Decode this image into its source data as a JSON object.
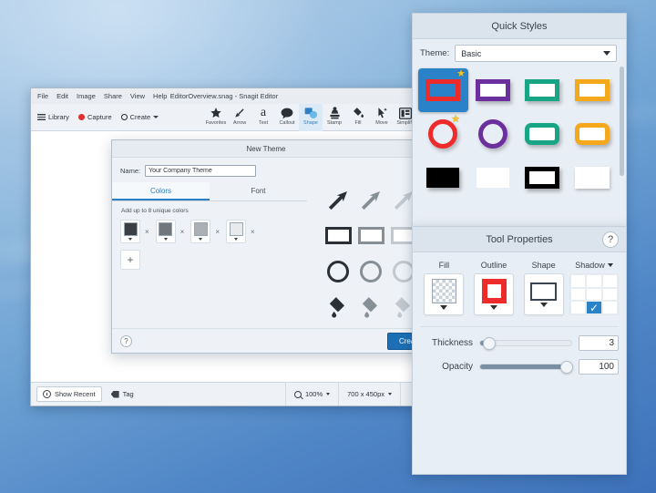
{
  "desktop": {
    "wallpaper_color": "#4f86c6"
  },
  "editor": {
    "title": "EditorOverview.snag - Snagit Editor",
    "menu": [
      "File",
      "Edit",
      "Image",
      "Share",
      "View",
      "Help"
    ],
    "toolbar_left": [
      {
        "label": "Library",
        "icon": "hamburger-icon"
      },
      {
        "label": "Capture",
        "icon": "record-dot-icon"
      },
      {
        "label": "Create",
        "icon": "circle-outline-icon"
      }
    ],
    "tools": [
      {
        "label": "Favorites",
        "icon": "star-icon",
        "active": false
      },
      {
        "label": "Arrow",
        "icon": "arrow-icon",
        "active": false
      },
      {
        "label": "Text",
        "icon": "text-a-icon",
        "active": false
      },
      {
        "label": "Callout",
        "icon": "callout-bubble-icon",
        "active": false
      },
      {
        "label": "Shape",
        "icon": "shape-icon",
        "active": true
      },
      {
        "label": "Stamp",
        "icon": "stamp-icon",
        "active": false
      },
      {
        "label": "Fill",
        "icon": "paint-bucket-icon",
        "active": false
      },
      {
        "label": "Move",
        "icon": "move-cursor-icon",
        "active": false
      },
      {
        "label": "Simplify",
        "icon": "simplify-icon",
        "active": false
      }
    ],
    "statusbar": {
      "show_recent": "Show Recent",
      "tag": "Tag",
      "zoom": "100%",
      "dimensions": "700 x 450px"
    }
  },
  "theme_dialog": {
    "title": "New Theme",
    "name_label": "Name:",
    "name_value": "Your Company Theme",
    "tabs": [
      {
        "label": "Colors",
        "selected": true
      },
      {
        "label": "Font",
        "selected": false
      }
    ],
    "hint": "Add up to 8 unique colors",
    "swatches": [
      {
        "color": "#3b3f44",
        "remove_label": "×"
      },
      {
        "color": "#6f767d",
        "remove_label": "×"
      },
      {
        "color": "#aab0b6",
        "remove_label": "×"
      },
      {
        "color": "#e8eaec",
        "remove_label": "×"
      }
    ],
    "add_label": "+",
    "help_label": "?",
    "create_label": "Create",
    "preview_rows": [
      {
        "kind": "arrow",
        "colors": [
          "#2b3036",
          "#868e96",
          "#c2c8ce"
        ]
      },
      {
        "kind": "rect",
        "colors": [
          "#2b3036",
          "#868e96",
          "#c2c8ce"
        ]
      },
      {
        "kind": "circle",
        "colors": [
          "#2b3036",
          "#868e96",
          "#c2c8ce"
        ]
      },
      {
        "kind": "bucket",
        "colors": [
          "#2b3036",
          "#868e96",
          "#c2c8ce"
        ]
      }
    ]
  },
  "quick_styles": {
    "title": "Quick Styles",
    "theme_label": "Theme:",
    "theme_value": "Basic",
    "styles": [
      {
        "shape": "rect",
        "color": "#ee2b2b",
        "selected": true,
        "favorite": true
      },
      {
        "shape": "rect",
        "color": "#6b2f9e",
        "selected": false,
        "favorite": false
      },
      {
        "shape": "rect",
        "color": "#17a585",
        "selected": false,
        "favorite": false
      },
      {
        "shape": "rect",
        "color": "#f5a81c",
        "selected": false,
        "favorite": false
      },
      {
        "shape": "circle",
        "color": "#ee2b2b",
        "selected": false,
        "favorite": true
      },
      {
        "shape": "circle",
        "color": "#6b2f9e",
        "selected": false,
        "favorite": false
      },
      {
        "shape": "round",
        "color": "#17a585",
        "selected": false,
        "favorite": false
      },
      {
        "shape": "round",
        "color": "#f5a81c",
        "selected": false,
        "favorite": false
      },
      {
        "shape": "solid",
        "color": "#000000",
        "selected": false,
        "favorite": false
      },
      {
        "shape": "solid",
        "color": "#ffffff",
        "selected": false,
        "favorite": false
      },
      {
        "shape": "rect",
        "color": "#000000",
        "selected": false,
        "favorite": false
      },
      {
        "shape": "rect",
        "color": "#ffffff",
        "selected": false,
        "favorite": false
      }
    ]
  },
  "tool_properties": {
    "title": "Tool Properties",
    "help_label": "?",
    "props": [
      {
        "label": "Fill",
        "kind": "checker",
        "has_caret": true
      },
      {
        "label": "Outline",
        "kind": "outline",
        "color": "#ee2b2b",
        "has_caret": true
      },
      {
        "label": "Shape",
        "kind": "shape",
        "has_caret": true
      },
      {
        "label": "Shadow",
        "kind": "shadow",
        "has_caret": true,
        "selected_cell": 8,
        "check": "✓"
      }
    ],
    "sliders": [
      {
        "label": "Thickness",
        "value": "3",
        "percent": 6
      },
      {
        "label": "Opacity",
        "value": "100",
        "percent": 94
      }
    ]
  }
}
